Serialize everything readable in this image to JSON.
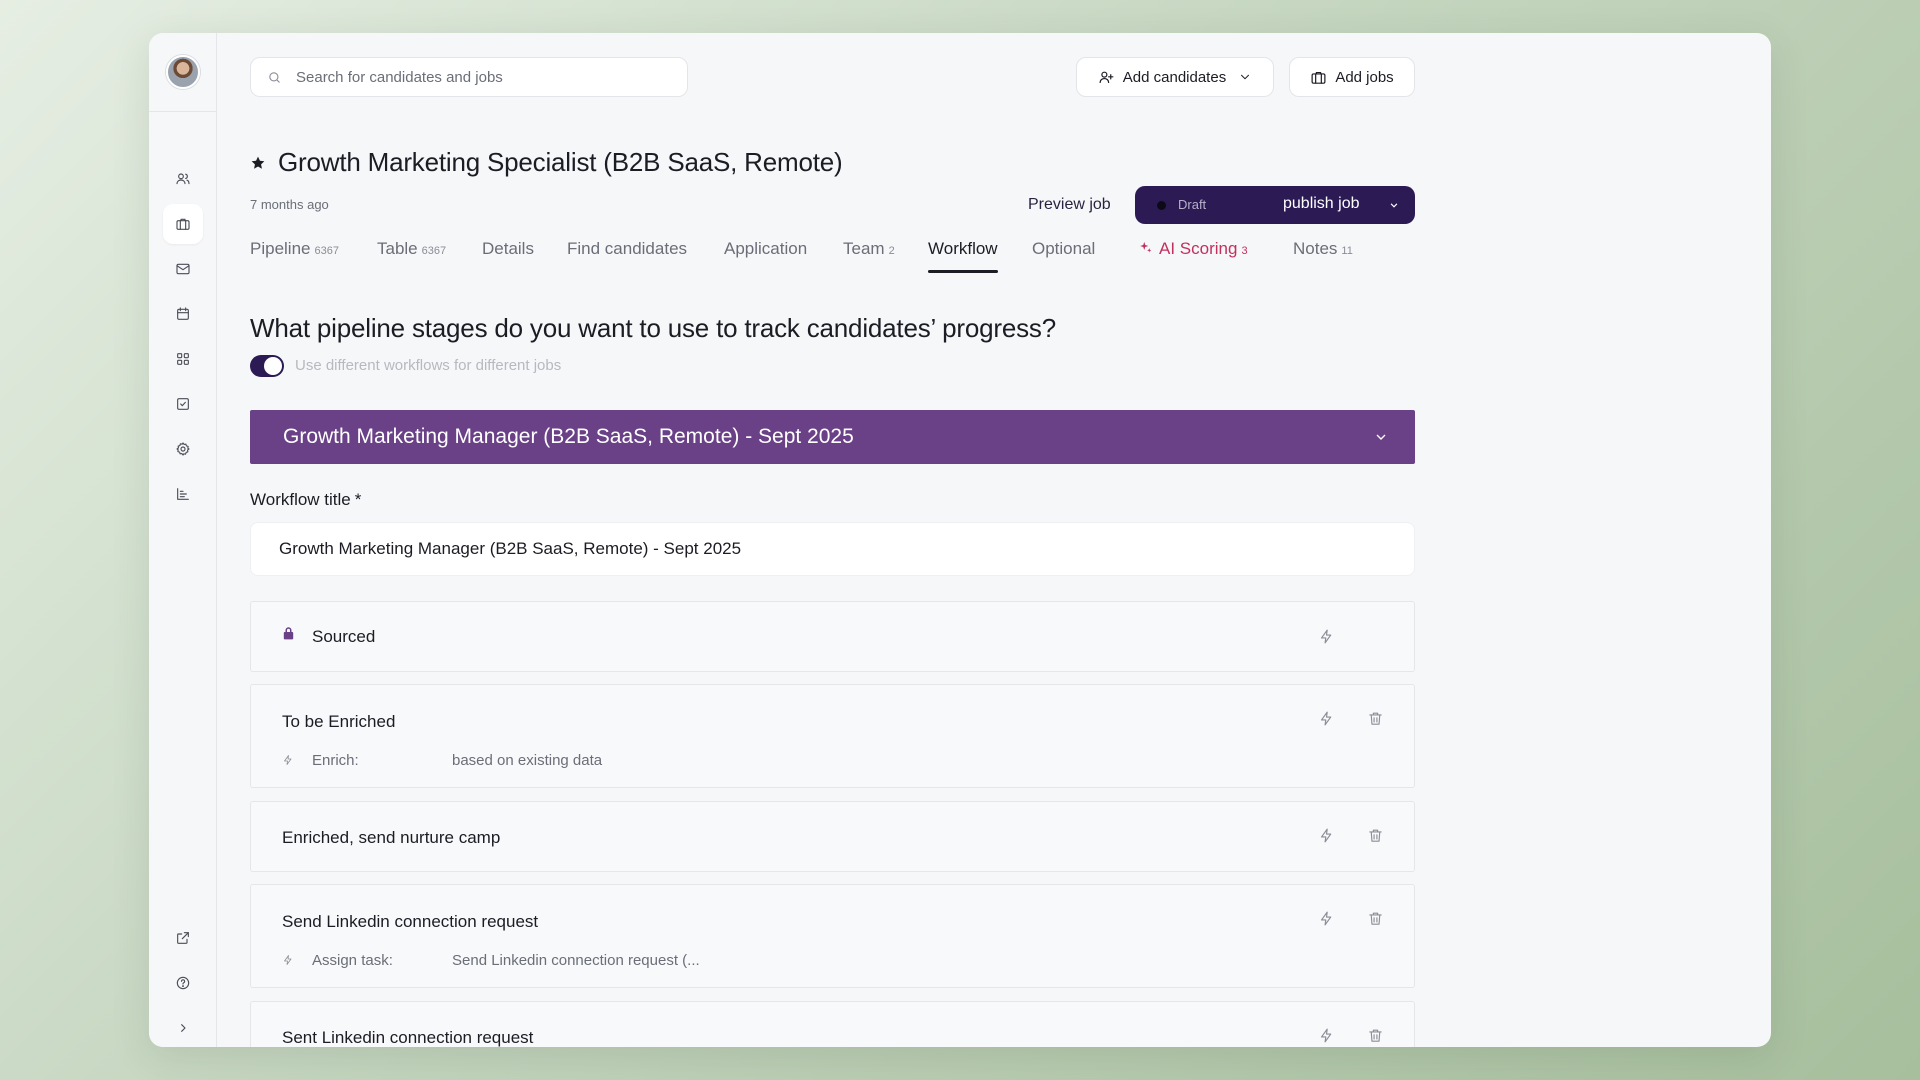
{
  "search": {
    "placeholder": "Search for candidates and jobs"
  },
  "header": {
    "add_candidates": "Add candidates",
    "add_jobs": "Add jobs"
  },
  "job": {
    "title": "Growth Marketing Specialist (B2B SaaS, Remote)",
    "age": "7 months ago",
    "preview": "Preview job",
    "status": "Draft",
    "publish": "publish job"
  },
  "tabs": [
    {
      "label": "Pipeline",
      "count": "6367"
    },
    {
      "label": "Table",
      "count": "6367"
    },
    {
      "label": "Details",
      "count": ""
    },
    {
      "label": "Find candidates",
      "count": ""
    },
    {
      "label": "Application",
      "count": ""
    },
    {
      "label": "Team",
      "count": "2"
    },
    {
      "label": "Workflow",
      "count": ""
    },
    {
      "label": "Optional",
      "count": ""
    },
    {
      "label": "AI Scoring",
      "count": "3"
    },
    {
      "label": "Notes",
      "count": "11"
    }
  ],
  "workflow": {
    "question": "What pipeline stages do you want to use to track candidates’ progress?",
    "toggle_label": "Use different workflows for different jobs",
    "selected": "Growth Marketing Manager (B2B SaaS, Remote) - Sept 2025",
    "title_label": "Workflow title",
    "required_mark": "*",
    "title_value": "Growth Marketing Manager (B2B SaaS, Remote) - Sept 2025"
  },
  "stages": [
    {
      "name": "Sourced"
    },
    {
      "name": "To be Enriched",
      "action_key": "Enrich:",
      "action_value": "based on existing data"
    },
    {
      "name": "Enriched, send nurture camp"
    },
    {
      "name": "Send Linkedin connection request",
      "action_key": "Assign task:",
      "action_value": "Send Linkedin connection request (..."
    },
    {
      "name": "Sent Linkedin connection request"
    }
  ],
  "colors": {
    "accent_dark": "#2c1a55",
    "workflow_bar": "#6a4187",
    "ai_scoring": "#c2305e"
  }
}
